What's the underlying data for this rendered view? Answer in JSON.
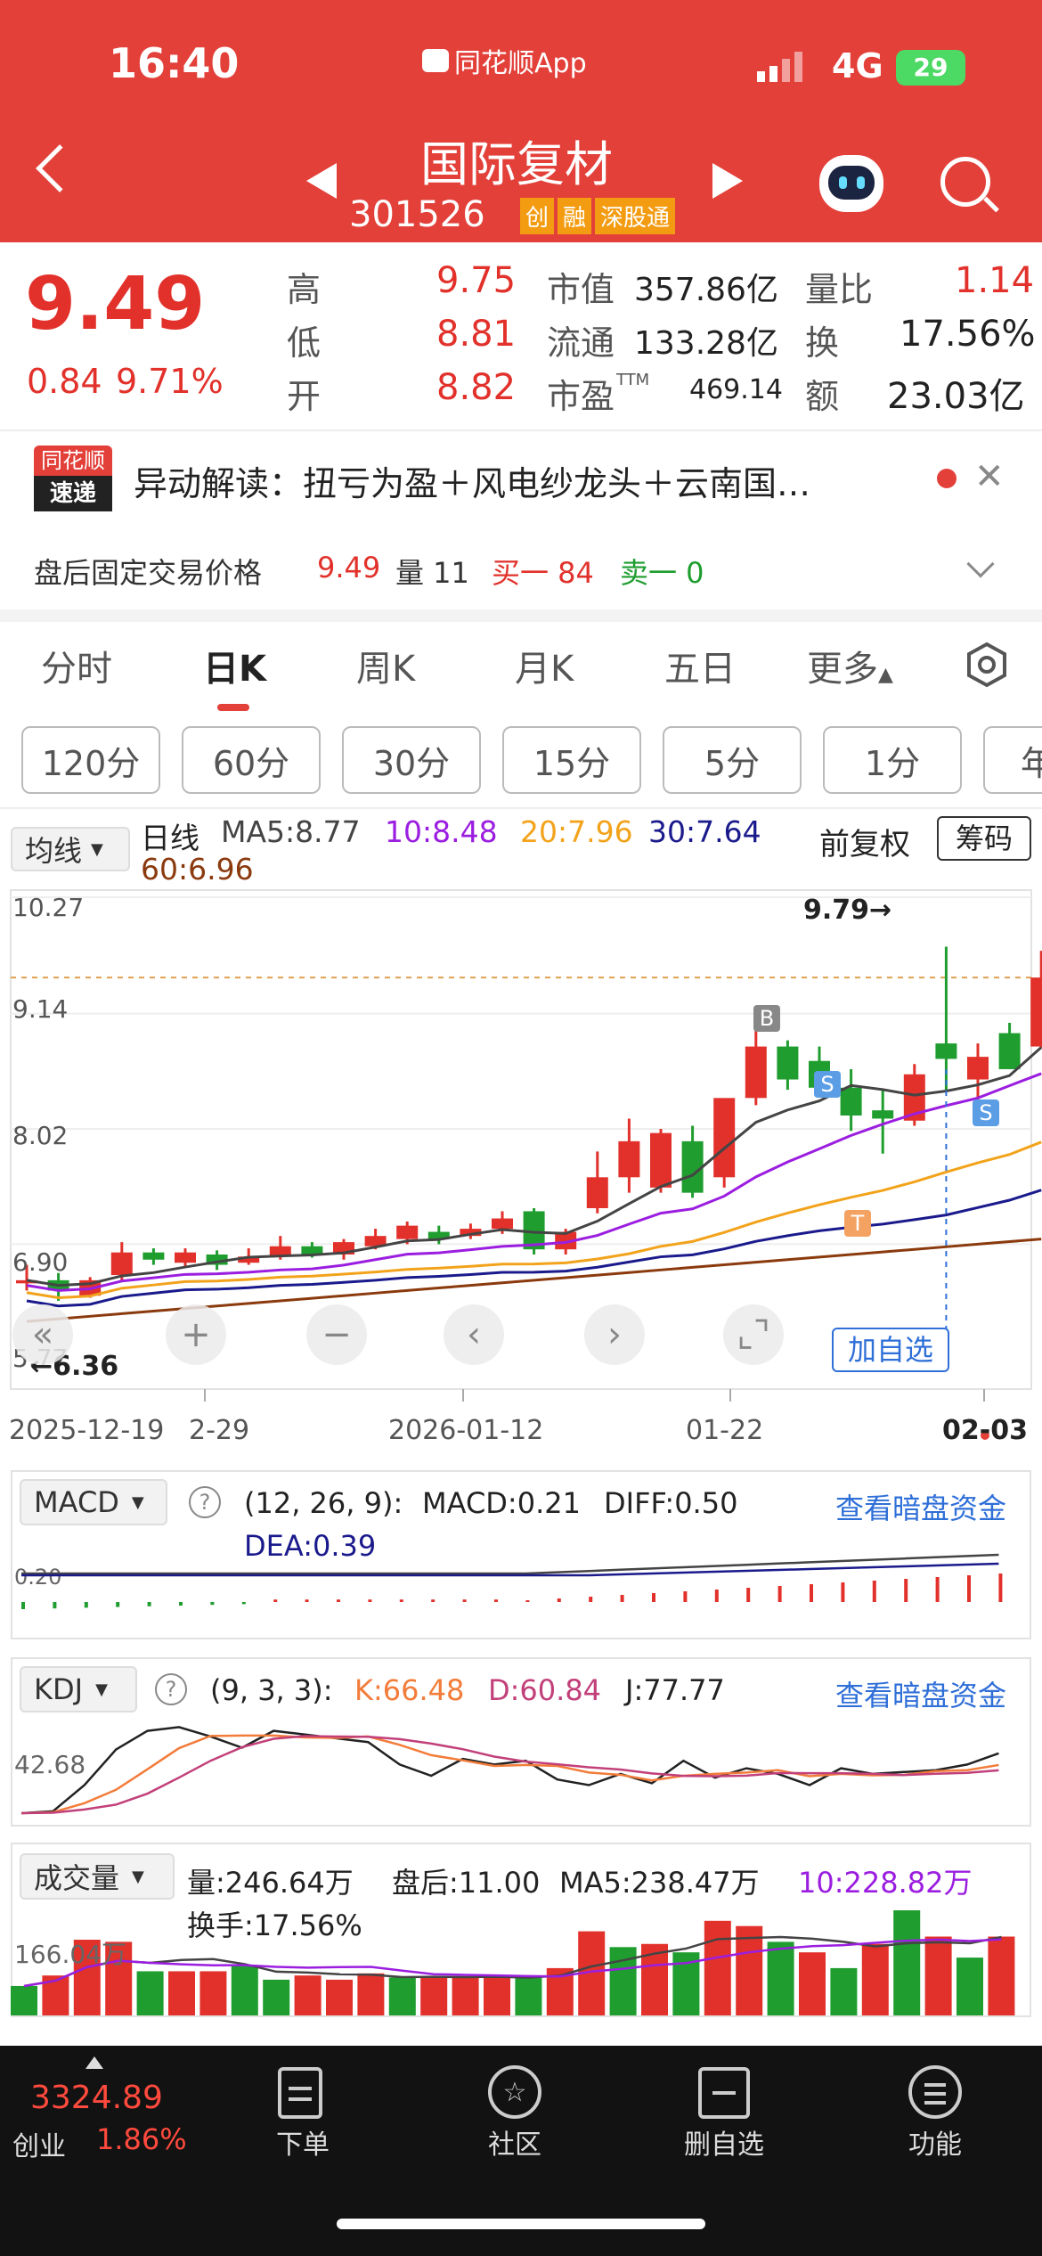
{
  "status": {
    "time": "16:40",
    "app_label": "同花顺App",
    "network": "4G",
    "battery": "29"
  },
  "header": {
    "title": "国际复材",
    "code": "301526",
    "tags": [
      "创",
      "融",
      "深股通"
    ]
  },
  "quote": {
    "price": "9.49",
    "change": "0.84",
    "change_pct": "9.71%",
    "stats": [
      {
        "label": "高",
        "value": "9.75"
      },
      {
        "label": "低",
        "value": "8.81"
      },
      {
        "label": "开",
        "value": "8.82"
      },
      {
        "label": "市值",
        "value": "357.86亿"
      },
      {
        "label": "流通",
        "value": "133.28亿"
      },
      {
        "label": "市盈",
        "sup": "TTM",
        "value": "469.14"
      },
      {
        "label": "量比",
        "value": "1.14"
      },
      {
        "label": "换",
        "value": "17.56%"
      },
      {
        "label": "额",
        "value": "23.03亿"
      }
    ]
  },
  "news": {
    "logo_top": "同花顺",
    "logo_bottom": "速递",
    "text": "异动解读：扭亏为盈＋风电纱龙头＋云南国…"
  },
  "after_hours": {
    "label": "盘后固定交易价格",
    "price": "9.49",
    "vol_label": "量 11",
    "buy": "买一 84",
    "sell": "卖一 0"
  },
  "tabs": [
    "分时",
    "日K",
    "周K",
    "月K",
    "五日",
    "更多"
  ],
  "periods": [
    "120分",
    "60分",
    "30分",
    "15分",
    "5分",
    "1分",
    "年"
  ],
  "ma_bar": {
    "selector": "均线",
    "type": "日线",
    "ma5": "MA5:8.77",
    "ma10": "10:8.48",
    "ma20": "20:7.96",
    "ma30": "30:7.64",
    "ma60": "60:6.96",
    "fq": "前复权",
    "chips": "筹码"
  },
  "colors": {
    "ma5": "#444444",
    "ma10": "#9b1ee0",
    "ma20": "#f2a31b",
    "ma30": "#1a1a8c",
    "ma60": "#8b3a0e",
    "up": "#e2312b",
    "down": "#1f9d2f"
  },
  "chart_data": {
    "type": "candlestick",
    "price_axis": [
      "10.27",
      "9.14",
      "8.02",
      "6.90",
      "5.77"
    ],
    "max_label": "9.79→",
    "min_label": "←6.36",
    "dates": [
      "2025-12-19",
      "2-29",
      "2026-01-12",
      "01-22",
      "02-03"
    ],
    "candles": [
      [
        6.52,
        6.7,
        6.45,
        6.55
      ],
      [
        6.55,
        6.62,
        6.35,
        6.45
      ],
      [
        6.4,
        6.58,
        6.38,
        6.55
      ],
      [
        6.6,
        6.92,
        6.55,
        6.82
      ],
      [
        6.82,
        6.86,
        6.7,
        6.75
      ],
      [
        6.72,
        6.86,
        6.68,
        6.82
      ],
      [
        6.8,
        6.84,
        6.65,
        6.7
      ],
      [
        6.72,
        6.86,
        6.7,
        6.78
      ],
      [
        6.78,
        6.98,
        6.75,
        6.88
      ],
      [
        6.88,
        6.92,
        6.77,
        6.8
      ],
      [
        6.8,
        6.95,
        6.75,
        6.92
      ],
      [
        6.88,
        7.05,
        6.85,
        6.98
      ],
      [
        6.95,
        7.12,
        6.9,
        7.08
      ],
      [
        7.02,
        7.08,
        6.9,
        6.95
      ],
      [
        6.98,
        7.1,
        6.95,
        7.05
      ],
      [
        7.05,
        7.22,
        7.0,
        7.15
      ],
      [
        7.22,
        7.25,
        6.8,
        6.85
      ],
      [
        6.85,
        7.05,
        6.8,
        7.02
      ],
      [
        7.25,
        7.8,
        7.2,
        7.55
      ],
      [
        7.55,
        8.12,
        7.4,
        7.9
      ],
      [
        7.45,
        8.02,
        7.4,
        7.98
      ],
      [
        7.9,
        8.05,
        7.35,
        7.4
      ],
      [
        7.55,
        8.1,
        7.45,
        8.32
      ],
      [
        8.32,
        9.0,
        8.25,
        8.82
      ],
      [
        8.82,
        8.88,
        8.4,
        8.5
      ],
      [
        8.68,
        8.82,
        8.35,
        8.42
      ],
      [
        8.42,
        8.6,
        8.0,
        8.15
      ],
      [
        8.2,
        8.4,
        7.78,
        8.12
      ],
      [
        8.1,
        8.65,
        8.05,
        8.55
      ],
      [
        8.85,
        9.79,
        8.4,
        8.7
      ],
      [
        8.5,
        8.85,
        8.3,
        8.72
      ],
      [
        8.95,
        9.05,
        8.6,
        8.6
      ],
      [
        8.82,
        9.75,
        8.81,
        9.49
      ]
    ],
    "buy_marker": "B",
    "sell_marker": "S",
    "t_marker": "T",
    "add_watch": "加自选"
  },
  "macd": {
    "selector": "MACD",
    "params": "(12, 26, 9):",
    "macd": "MACD:0.21",
    "diff": "DIFF:0.50",
    "dea": "DEA:0.39",
    "link": "查看暗盘资金",
    "axis": "0.20"
  },
  "kdj": {
    "selector": "KDJ",
    "params": "(9, 3, 3):",
    "k": "K:66.48",
    "d": "D:60.84",
    "j": "J:77.77",
    "link": "查看暗盘资金",
    "axis": "42.68"
  },
  "volume": {
    "selector": "成交量",
    "vol": "量:246.64万",
    "after": "盘后:11.00",
    "ma5": "MA5:238.47万",
    "ma10": "10:228.82万",
    "turnover": "换手:17.56%",
    "axis": "166.04万",
    "bars": [
      [
        0.28,
        "d"
      ],
      [
        0.38,
        "u"
      ],
      [
        0.72,
        "u"
      ],
      [
        0.7,
        "u"
      ],
      [
        0.42,
        "d"
      ],
      [
        0.42,
        "u"
      ],
      [
        0.42,
        "u"
      ],
      [
        0.48,
        "d"
      ],
      [
        0.34,
        "d"
      ],
      [
        0.38,
        "u"
      ],
      [
        0.34,
        "u"
      ],
      [
        0.4,
        "u"
      ],
      [
        0.36,
        "d"
      ],
      [
        0.36,
        "u"
      ],
      [
        0.36,
        "u"
      ],
      [
        0.36,
        "u"
      ],
      [
        0.36,
        "d"
      ],
      [
        0.45,
        "u"
      ],
      [
        0.8,
        "u"
      ],
      [
        0.65,
        "d"
      ],
      [
        0.68,
        "u"
      ],
      [
        0.6,
        "d"
      ],
      [
        0.9,
        "u"
      ],
      [
        0.85,
        "u"
      ],
      [
        0.7,
        "d"
      ],
      [
        0.6,
        "u"
      ],
      [
        0.45,
        "d"
      ],
      [
        0.68,
        "u"
      ],
      [
        1.0,
        "d"
      ],
      [
        0.75,
        "u"
      ],
      [
        0.55,
        "d"
      ],
      [
        0.75,
        "u"
      ]
    ]
  },
  "index": {
    "value": "3324.89",
    "name": "创业",
    "pct": "1.86%"
  },
  "nav": [
    {
      "label": "下单"
    },
    {
      "label": "社区"
    },
    {
      "label": "删自选"
    },
    {
      "label": "功能"
    }
  ]
}
